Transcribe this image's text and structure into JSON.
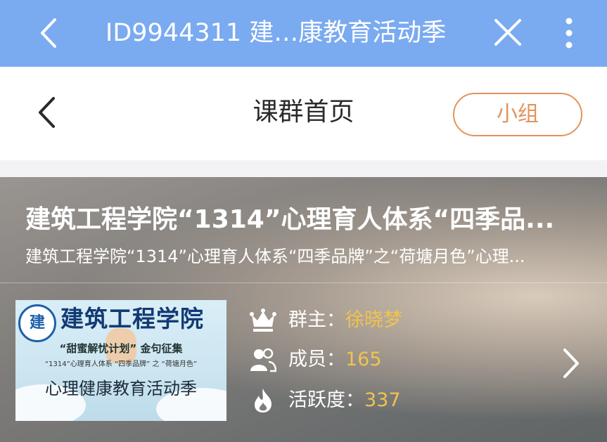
{
  "topbar": {
    "title": "ID9944311 建…康教育活动季",
    "back_icon": "chevron-left-icon",
    "close_icon": "close-icon",
    "more_icon": "more-vertical-icon"
  },
  "nav": {
    "title": "课群首页",
    "group_button": "小组"
  },
  "hero": {
    "title": "建筑工程学院“1314”心理育人体系“四季品...",
    "subtitle": "建筑工程学院“1314”心理育人体系“四季品牌”之“荷塘月色”心理...",
    "cover": {
      "school": "建筑工程学院",
      "line1": "“甜蜜解忧计划” 金句征集",
      "line2": "“1314”心理育人体系 “四季品牌” 之 “荷塘月色”",
      "line3": "心理健康教育活动季",
      "seal_char": "建"
    },
    "owner_label": "群主：",
    "owner_value": "徐晓梦",
    "members_label": "成员：",
    "members_value": "165",
    "activity_label": "活跃度：",
    "activity_value": "337"
  },
  "colors": {
    "topbar": "#7aaaf0",
    "accent_orange": "#e2935a",
    "value_gold": "#f0c34e"
  }
}
